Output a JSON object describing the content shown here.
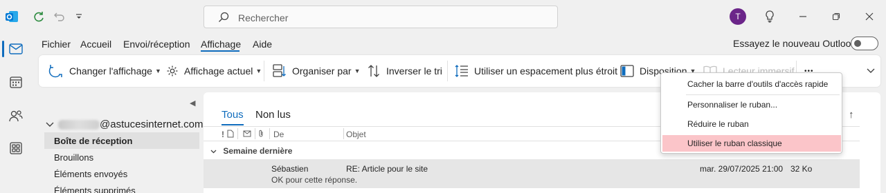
{
  "titlebar": {
    "search_placeholder": "Rechercher",
    "avatar_initial": "T"
  },
  "menu": {
    "tabs": [
      "Fichier",
      "Accueil",
      "Envoi/réception",
      "Affichage",
      "Aide"
    ],
    "active_tab": "Affichage",
    "new_outlook_label": "Essayez le nouveau Outlook"
  },
  "ribbon": {
    "change_view": "Changer l'affichage",
    "current_view": "Affichage actuel",
    "arrange_by": "Organiser par",
    "reverse_sort": "Inverser le tri",
    "spacing": "Utiliser un espacement plus étroit",
    "layout": "Disposition",
    "reading_pane": "Lecteur immersif",
    "more": "•••"
  },
  "folders": {
    "account": "@astucesinternet.com",
    "items": [
      "Boîte de réception",
      "Brouillons",
      "Éléments envoyés",
      "Éléments supprimés"
    ],
    "selected": "Boîte de réception"
  },
  "message_list": {
    "tabs": [
      "Tous",
      "Non lus"
    ],
    "columns": {
      "from": "De",
      "subject": "Objet"
    },
    "group_label": "Semaine dernière",
    "messages": [
      {
        "sender": "Sébastien",
        "subject": "RE: Article pour le site",
        "preview": "OK pour cette réponse.",
        "date": "mar. 29/07/2025 21:00",
        "size": "32 Ko"
      }
    ]
  },
  "context_menu": {
    "items": [
      "Cacher la barre d'outils d'accès rapide",
      "Personnaliser le ruban...",
      "Réduire le ruban",
      "Utiliser le ruban classique"
    ],
    "highlighted_index": 3
  },
  "colors": {
    "accent": "#0f6cbd",
    "avatar": "#6b2589",
    "highlight": "#fbc5c9",
    "outlook_blue": "#0078d4"
  }
}
